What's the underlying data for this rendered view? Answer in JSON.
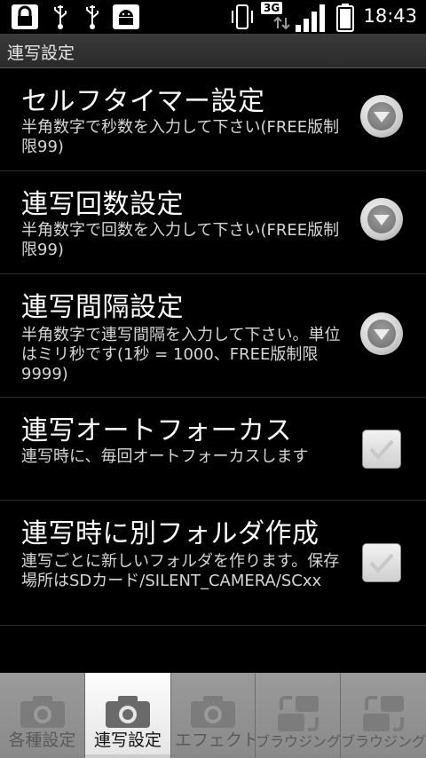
{
  "status_bar": {
    "time": "18:43",
    "network": "3G"
  },
  "title_bar": {
    "title": "連写設定"
  },
  "preferences": [
    {
      "title": "セルフタイマー設定",
      "summary": "半角数字で秒数を入力して下さい(FREE版制限99)",
      "widget": "dropdown"
    },
    {
      "title": "連写回数設定",
      "summary": "半角数字で回数を入力して下さい(FREE版制限99)",
      "widget": "dropdown"
    },
    {
      "title": "連写間隔設定",
      "summary": "半角数字で連写間隔を入力して下さい。単位はミリ秒です(1秒 = 1000、FREE版制限9999)",
      "widget": "dropdown"
    },
    {
      "title": "連写オートフォーカス",
      "summary": "連写時に、毎回オートフォーカスします",
      "widget": "checkbox",
      "checked": true
    },
    {
      "title": "連写時に別フォルダ作成",
      "summary": "連写ごとに新しいフォルダを作ります。保存場所はSDカード/SILENT_CAMERA/SCxx",
      "widget": "checkbox",
      "checked": true
    }
  ],
  "tabs": [
    {
      "label": "各種設定",
      "icon": "camera-icon",
      "active": false
    },
    {
      "label": "連写設定",
      "icon": "camera-icon",
      "active": true
    },
    {
      "label": "エフェクト",
      "icon": "camera-icon",
      "active": false
    },
    {
      "label": "ブラウジング",
      "icon": "camera-rotate-icon",
      "active": false
    },
    {
      "label": "ブラウジング",
      "icon": "camera-rotate-icon",
      "active": false
    }
  ],
  "colors": {
    "background": "#000000",
    "tab_active": "#f0f0f0",
    "tab_inactive": "#8f8f8f"
  }
}
